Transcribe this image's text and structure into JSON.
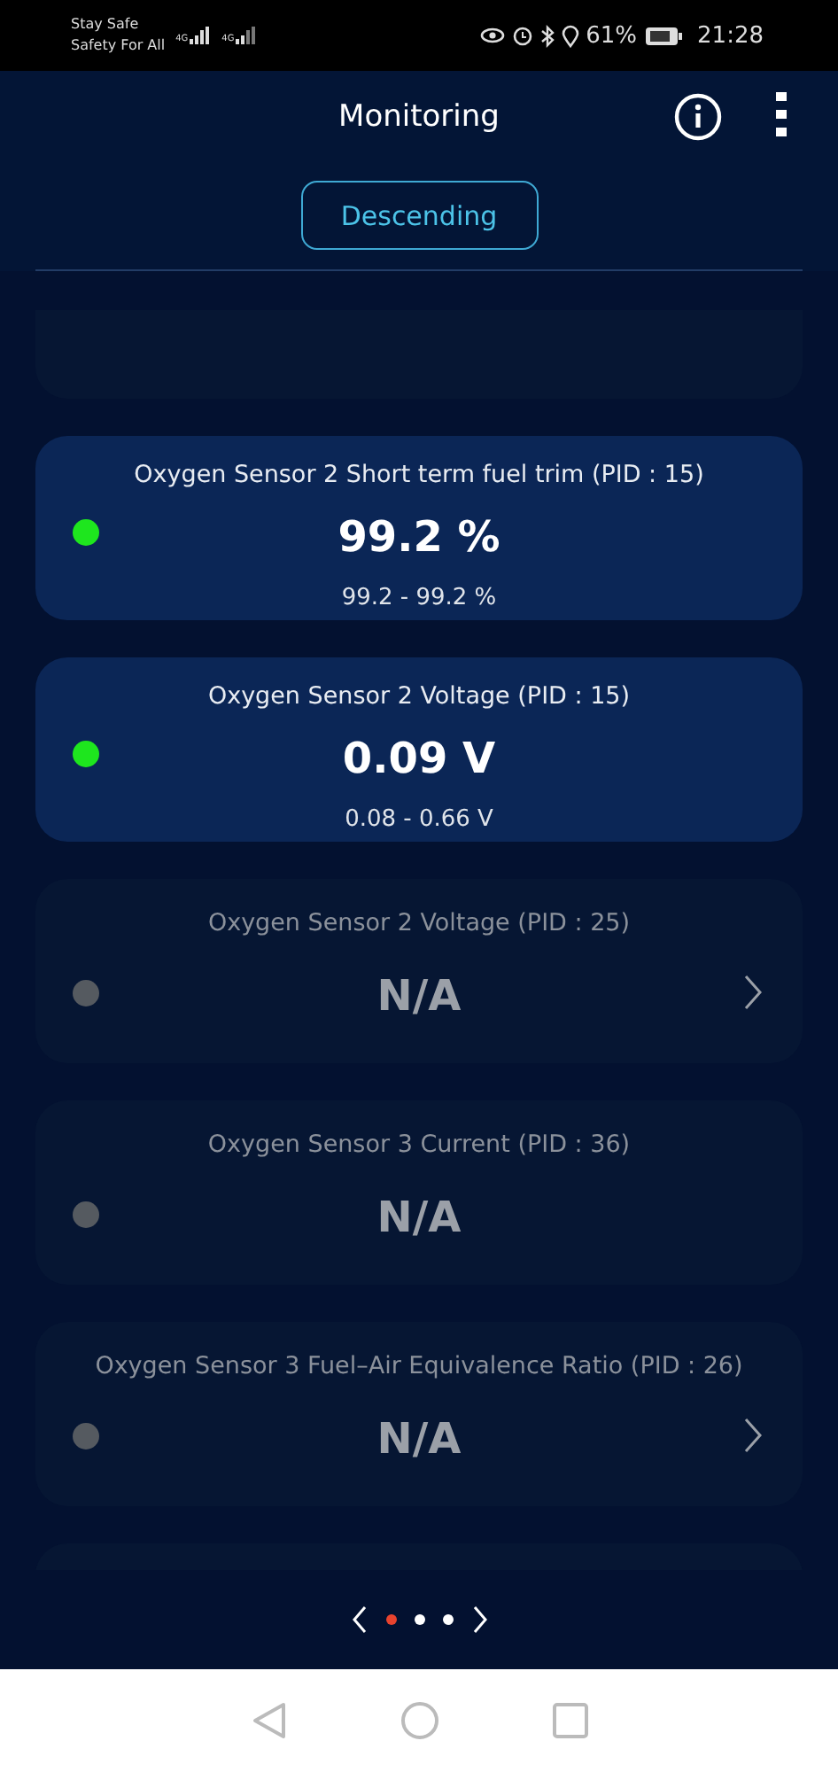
{
  "status_bar": {
    "carrier_line_1": "Stay Safe",
    "carrier_line_2": "Safety For All",
    "network_1": "4G",
    "network_2": "4G",
    "battery": "61%",
    "time": "21:28"
  },
  "header": {
    "title": "Monitoring"
  },
  "sort_button": {
    "label": "Descending"
  },
  "sensors": [
    {
      "title": "Oxygen Sensor 2 Short term fuel trim (PID : 15)",
      "value": "99.2 %",
      "range": "99.2 - 99.2 %",
      "active": true,
      "chevron": false
    },
    {
      "title": "Oxygen Sensor 2 Voltage (PID : 15)",
      "value": "0.09 V",
      "range": "0.08 - 0.66 V",
      "active": true,
      "chevron": false
    },
    {
      "title": "Oxygen Sensor 2 Voltage (PID : 25)",
      "value": "N/A",
      "active": false,
      "chevron": true
    },
    {
      "title": "Oxygen Sensor 3 Current (PID : 36)",
      "value": "N/A",
      "active": false,
      "chevron": false
    },
    {
      "title": "Oxygen Sensor 3 Fuel–Air Equivalence Ratio (PID : 26)",
      "value": "N/A",
      "active": false,
      "chevron": true
    }
  ],
  "pages": [
    {
      "selected": true
    },
    {
      "selected": false
    },
    {
      "selected": false
    }
  ]
}
